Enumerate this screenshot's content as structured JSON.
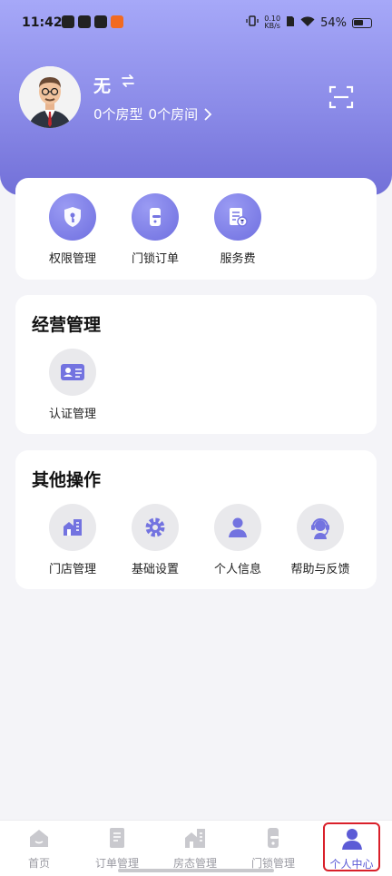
{
  "status_bar": {
    "time": "11:42",
    "net_speed_top": "0.10",
    "net_speed_unit": "KB/s",
    "battery": "54%"
  },
  "colors": {
    "accent": "#6f6fe0",
    "hero_top": "#a6a8f8",
    "hero_bottom": "#7270d8",
    "active_tab_outline": "#d9202a"
  },
  "profile": {
    "name": "无",
    "room_types": "0个房型",
    "rooms": "0个房间"
  },
  "quick_actions": [
    {
      "label": "权限管理",
      "icon": "shield-key-icon"
    },
    {
      "label": "门锁订单",
      "icon": "door-lock-icon"
    },
    {
      "label": "服务费",
      "icon": "invoice-yen-icon"
    }
  ],
  "business": {
    "title": "经营管理",
    "items": [
      {
        "label": "认证管理",
        "icon": "id-card-icon"
      }
    ]
  },
  "other": {
    "title": "其他操作",
    "items": [
      {
        "label": "门店管理",
        "icon": "store-icon"
      },
      {
        "label": "基础设置",
        "icon": "gear-icon"
      },
      {
        "label": "个人信息",
        "icon": "person-icon"
      },
      {
        "label": "帮助与反馈",
        "icon": "headset-icon"
      }
    ]
  },
  "bottom_nav": {
    "active": "个人中心",
    "items": [
      {
        "label": "首页",
        "icon": "home-icon"
      },
      {
        "label": "订单管理",
        "icon": "order-doc-icon"
      },
      {
        "label": "房态管理",
        "icon": "building-icon"
      },
      {
        "label": "门锁管理",
        "icon": "lock-icon"
      },
      {
        "label": "个人中心",
        "icon": "person-icon"
      }
    ]
  }
}
